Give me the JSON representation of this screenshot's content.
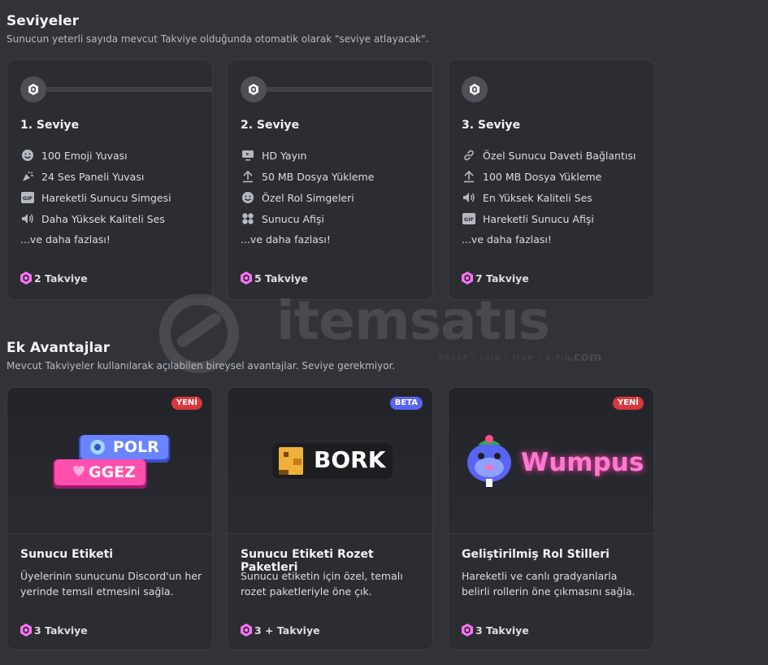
{
  "tiers_section": {
    "title": "Seviyeler",
    "subtitle": "Sunucun yeterli sayıda mevcut Takviye olduğunda otomatik olarak \"seviye atlayacak\"."
  },
  "tiers": [
    {
      "title": "1. Seviye",
      "perks": [
        {
          "icon": "emoji-icon",
          "label": "100 Emoji Yuvası"
        },
        {
          "icon": "soundboard-icon",
          "label": "24 Ses Paneli Yuvası"
        },
        {
          "icon": "gif-icon",
          "label": "Hareketli Sunucu Simgesi"
        },
        {
          "icon": "speaker-icon",
          "label": "Daha Yüksek Kaliteli Ses"
        }
      ],
      "more": "...ve daha fazlası!",
      "boosts": "2 Takviye"
    },
    {
      "title": "2. Seviye",
      "perks": [
        {
          "icon": "stream-icon",
          "label": "HD Yayın"
        },
        {
          "icon": "upload-icon",
          "label": "50 MB Dosya Yükleme"
        },
        {
          "icon": "emoji-icon",
          "label": "Özel Rol Simgeleri"
        },
        {
          "icon": "banner-icon",
          "label": "Sunucu Afişi"
        }
      ],
      "more": "...ve daha fazlası!",
      "boosts": "5 Takviye"
    },
    {
      "title": "3. Seviye",
      "perks": [
        {
          "icon": "link-icon",
          "label": "Özel Sunucu Daveti Bağlantısı"
        },
        {
          "icon": "upload-icon",
          "label": "100 MB Dosya Yükleme"
        },
        {
          "icon": "speaker-icon",
          "label": "En Yüksek Kaliteli Ses"
        },
        {
          "icon": "gif-icon",
          "label": "Hareketli Sunucu Afişi"
        }
      ],
      "more": "...ve daha fazlası!",
      "boosts": "7 Takviye"
    }
  ],
  "extras_section": {
    "title": "Ek Avantajlar",
    "subtitle": "Mevcut Takviyeler kullanılarak açılabilen bireysel avantajlar. Seviye gerekmiyor."
  },
  "extras": [
    {
      "tag": "YENİ",
      "title": "Sunucu Etiketi",
      "desc": "Üyelerinin sunucunu Discord'un her yerinde temsil etmesini sağla.",
      "boosts": "3 Takviye",
      "art_labels": [
        "POLR",
        "GGEZ"
      ]
    },
    {
      "tag": "BETA",
      "title": "Sunucu Etiketi Rozet Paketleri",
      "desc": "Sunucu etiketin için özel, temalı rozet paketleriyle öne çık.",
      "boosts": "3 + Takviye",
      "art_labels": [
        "BORK"
      ]
    },
    {
      "tag": "YENİ",
      "title": "Geliştirilmiş Rol Stilleri",
      "desc": "Hareketli ve canlı gradyanlarla belirli rollerin öne çıkmasını sağla.",
      "boosts": "3 Takviye",
      "art_labels": [
        "Wumpus"
      ]
    }
  ],
  "watermark": {
    "text": "itemsatıs",
    "tagline": "HESAP / SKIN / ITEM / E-PIN",
    "suffix": ".com"
  },
  "colors": {
    "background": "#323339",
    "card": "#2b2d31",
    "boost_pink": "#ff73fa",
    "new_tag": "#da373c",
    "beta_tag": "#5865f2"
  }
}
